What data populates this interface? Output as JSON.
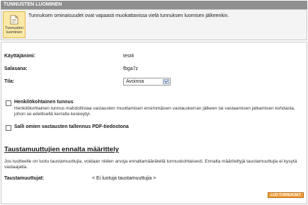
{
  "header": {
    "title": "TUNNUSTEN LUOMINEN"
  },
  "info": {
    "button_label_line1": "Tunnusten",
    "button_label_line2": "luominen",
    "text": "Tunnuksen ominaisuudet ovat vapaasti muokattavissa vielä tunnuksen luomisen jälkeenkin."
  },
  "form": {
    "username_label": "Käyttäjänimi:",
    "username_value": "test4",
    "password_label": "Salasana:",
    "password_value": "fbga7z",
    "state_label": "Tila:",
    "state_value": "Avoinna"
  },
  "options": {
    "personal_label": "Henkilökohtainen tunnus",
    "personal_desc": "Henkilökohtainen tunnus mahdollistaa vastausten muuttamisen ensimmäisen vastauskerran jälkeen tai vastaamisen jatkamisen kohdasta, johon se edellisellä kerralla keskeytyi.",
    "pdf_label": "Salli omien vastausten tallennus PDF-tiedostona"
  },
  "background": {
    "title": "Taustamuuttujien ennalta määrittely",
    "desc": "Jos tuotteelle on luotu taustamuuttujia, voidaan niiden arvoja ennaltamäärätellä tunnuskohtaisesti. Ennalta määriteltyjä taustamuuttujia ei kysytä vastaajalta.",
    "vars_label": "Taustamuuttujat:",
    "vars_value": "< Ei luotuja taustamuuttujia >"
  },
  "actions": {
    "create_label": "LUO TUNNUKSET"
  },
  "colors": {
    "titlebar": "#8f8f8f",
    "button": "#f0a040",
    "info_button": "#fbe9a8"
  }
}
